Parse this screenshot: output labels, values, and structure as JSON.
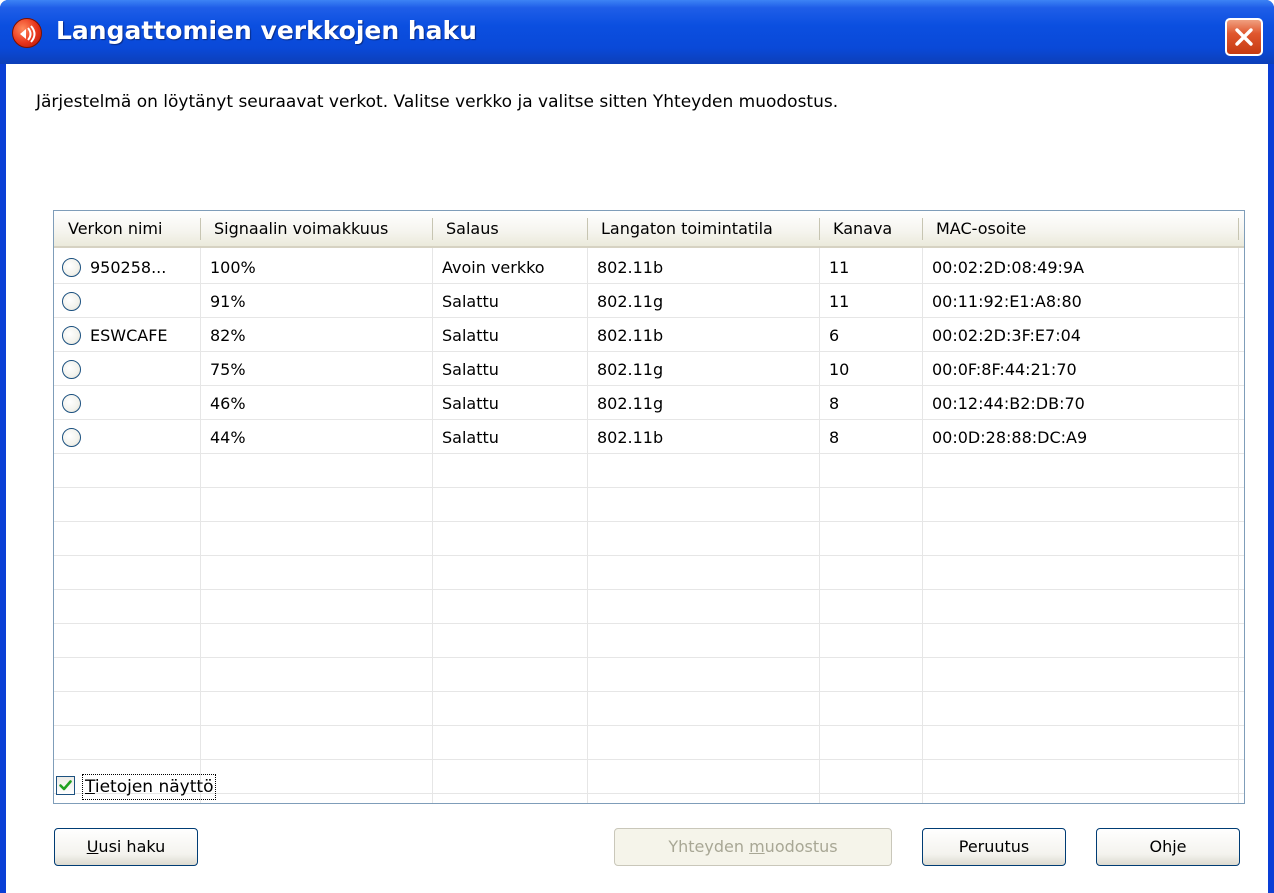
{
  "window": {
    "title": "Langattomien verkkojen haku",
    "close_icon": "close-icon",
    "app_icon": "wireless-scan-icon"
  },
  "instruction": "Järjestelmä on löytänyt seuraavat verkot. Valitse verkko ja valitse sitten Yhteyden muodostus.",
  "table": {
    "columns": [
      "Verkon nimi",
      "Signaalin voimakkuus",
      "Salaus",
      "Langaton toimintatila",
      "Kanava",
      "MAC-osoite"
    ],
    "rows": [
      {
        "name": "950258...",
        "signal": "100%",
        "encryption": "Avoin verkko",
        "mode": "802.11b",
        "channel": "11",
        "mac": "00:02:2D:08:49:9A"
      },
      {
        "name": "",
        "signal": "91%",
        "encryption": "Salattu",
        "mode": "802.11g",
        "channel": "11",
        "mac": "00:11:92:E1:A8:80"
      },
      {
        "name": "ESWCAFE",
        "signal": "82%",
        "encryption": "Salattu",
        "mode": "802.11b",
        "channel": "6",
        "mac": "00:02:2D:3F:E7:04"
      },
      {
        "name": "",
        "signal": "75%",
        "encryption": "Salattu",
        "mode": "802.11g",
        "channel": "10",
        "mac": "00:0F:8F:44:21:70"
      },
      {
        "name": "",
        "signal": "46%",
        "encryption": "Salattu",
        "mode": "802.11g",
        "channel": "8",
        "mac": "00:12:44:B2:DB:70"
      },
      {
        "name": "",
        "signal": "44%",
        "encryption": "Salattu",
        "mode": "802.11b",
        "channel": "8",
        "mac": "00:0D:28:88:DC:A9"
      }
    ]
  },
  "details_checkbox": {
    "label_first": "T",
    "label_rest": "ietojen näyttö",
    "checked": true
  },
  "buttons": {
    "new_search_first": "U",
    "new_search_rest": "usi haku",
    "connect_before": "Yhteyden ",
    "connect_mnemonic": "m",
    "connect_after": "uodostus",
    "cancel": "Peruutus",
    "help": "Ohje"
  }
}
